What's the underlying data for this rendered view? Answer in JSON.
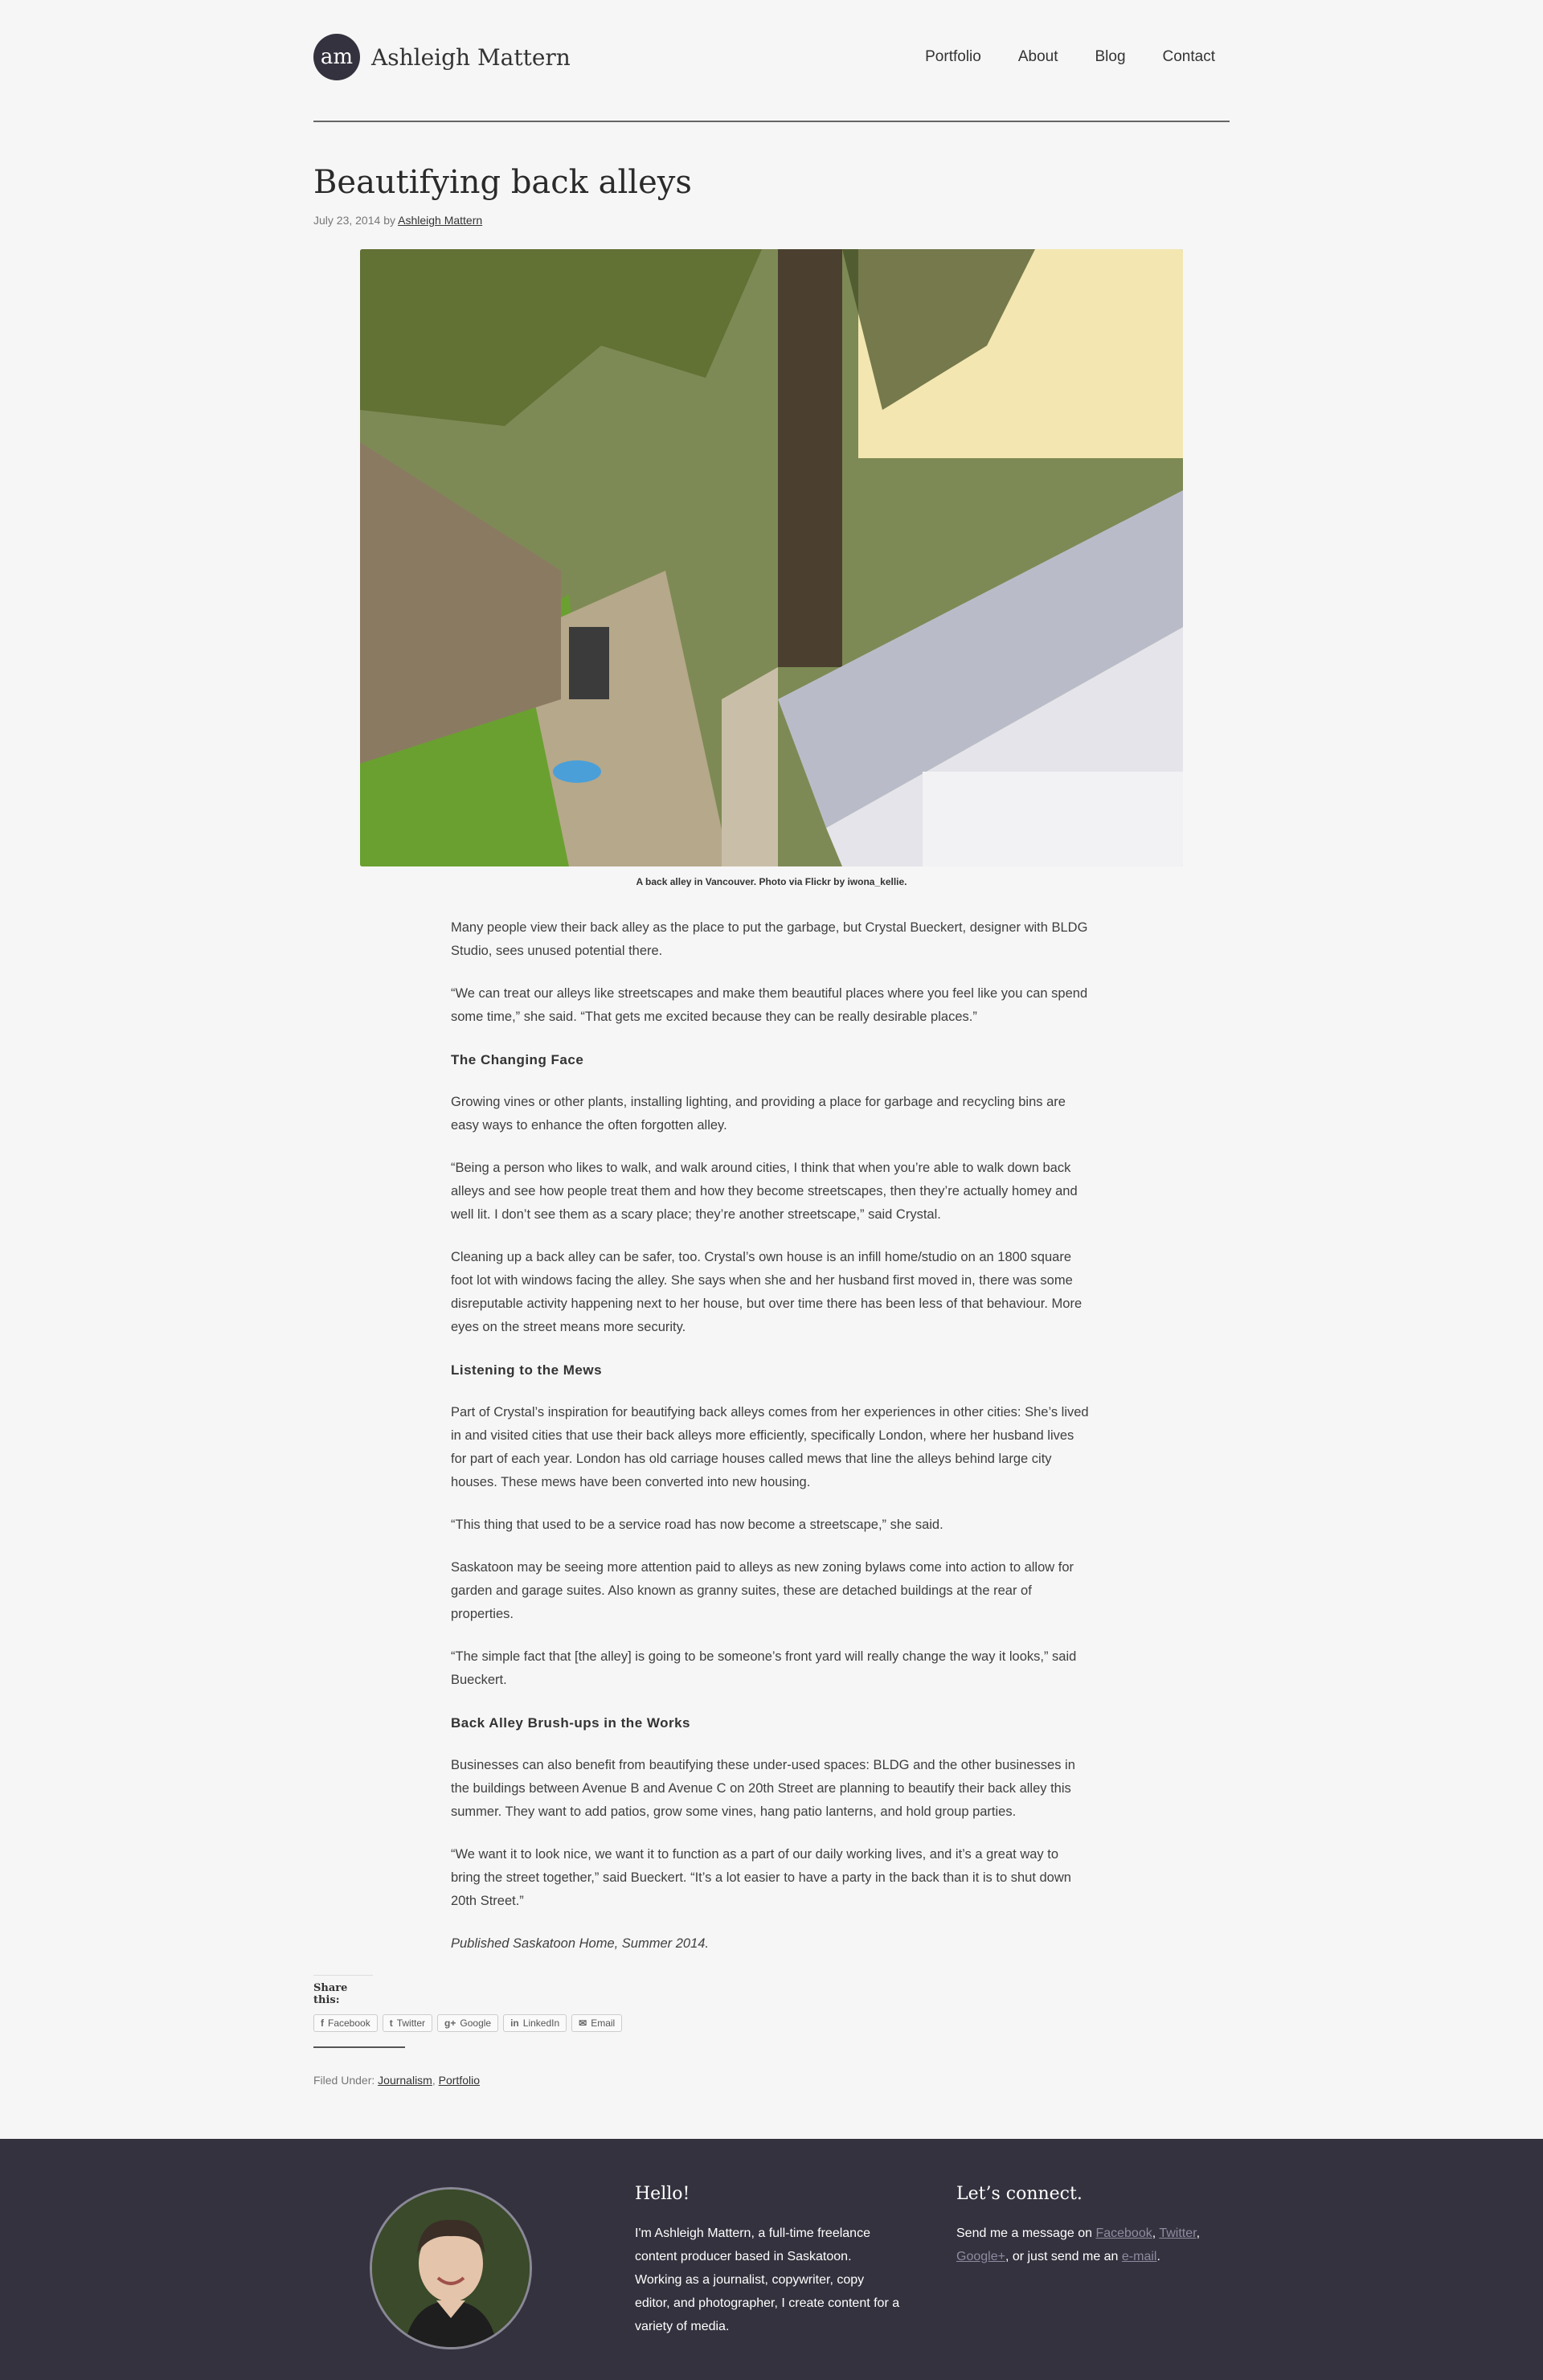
{
  "header": {
    "logo_initials": "am",
    "site_name": "Ashleigh Mattern",
    "nav": [
      "Portfolio",
      "About",
      "Blog",
      "Contact"
    ]
  },
  "post": {
    "title": "Beautifying back alleys",
    "date": "July 23, 2014",
    "by": "by",
    "author": "Ashleigh Mattern",
    "caption": "A back alley in Vancouver. Photo via Flickr by iwona_kellie.",
    "paragraphs": [
      "Many people view their back alley as the place to put the garbage, but Crystal Bueckert, designer with BLDG Studio, sees unused potential there.",
      "“We can treat our alleys like streetscapes and make them beautiful places where you feel like you can spend some time,” she said. “That gets me excited because they can be really desirable places.”"
    ],
    "h1": "The Changing Face",
    "paragraphs2": [
      "Growing vines or other plants, installing lighting, and providing a place for garbage and recycling bins are easy ways to enhance the often forgotten alley.",
      "“Being a person who likes to walk, and walk around cities, I think that when you’re able to walk down back alleys and see how people treat them and how they become streetscapes, then they’re actually homey and well lit. I don’t see them as a scary place; they’re another streetscape,” said Crystal.",
      "Cleaning up a back alley can be safer, too. Crystal’s own house is an infill home/studio on an 1800 square foot lot with windows facing the alley. She says when she and her husband first moved in, there was some disreputable activity happening next to her house, but over time there has been less of that behaviour. More eyes on the street means more security."
    ],
    "h2": "Listening to the Mews",
    "paragraphs3": [
      "Part of Crystal’s inspiration for beautifying back alleys comes from her experiences in other cities: She’s lived in and visited cities that use their back alleys more efficiently, specifically London, where her husband lives for part of each year. London has old carriage houses called mews that line the alleys behind large city houses. These mews have been converted into new housing.",
      "“This thing that used to be a service road has now become a streetscape,” she said.",
      "Saskatoon may be seeing more attention paid to alleys as new zoning bylaws come into action to allow for garden and garage suites. Also known as granny suites, these are detached buildings at the rear of properties.",
      "“The simple fact that [the alley] is going to be someone’s front yard will really change the way it looks,” said Bueckert."
    ],
    "h3": "Back Alley Brush-ups in the Works",
    "paragraphs4": [
      "Businesses can also benefit from beautifying these under-used spaces: BLDG and the other businesses in the buildings between Avenue B and Avenue C on 20th Street are planning to beautify their back alley this summer. They want to add patios, grow some vines, hang patio lanterns, and hold group parties.",
      "“We want it to look nice, we want it to function as a part of our daily working lives, and it’s a great way to bring the street together,” said Bueckert. “It’s a lot easier to have a party in the back than it is to shut down 20th Street.”"
    ],
    "published": "Published Saskatoon Home, Summer 2014."
  },
  "share": {
    "title": "Share this:",
    "buttons": [
      {
        "icon": "f",
        "label": "Facebook"
      },
      {
        "icon": "t",
        "label": "Twitter"
      },
      {
        "icon": "g+",
        "label": "Google"
      },
      {
        "icon": "in",
        "label": "LinkedIn"
      },
      {
        "icon": "✉",
        "label": "Email"
      }
    ]
  },
  "filed": {
    "label": "Filed Under:",
    "cat1": "Journalism",
    "sep": ",",
    "cat2": "Portfolio"
  },
  "footer": {
    "hello_title": "Hello!",
    "hello_text": "I'm Ashleigh Mattern, a full-time freelance content producer based in Saskatoon. Working as a journalist, copywriter, copy editor, and photographer, I create content for a variety of media.",
    "connect_title": "Let’s connect.",
    "connect_prefix": "Send me a message on",
    "facebook": "Facebook",
    "twitter": "Twitter",
    "googleplus": "Google+",
    "connect_mid": ", or just send me an",
    "email": "e-mail",
    "connect_end": "."
  },
  "colors": {
    "footer_bg": "#34323e",
    "page_bg": "#f6f6f6"
  }
}
